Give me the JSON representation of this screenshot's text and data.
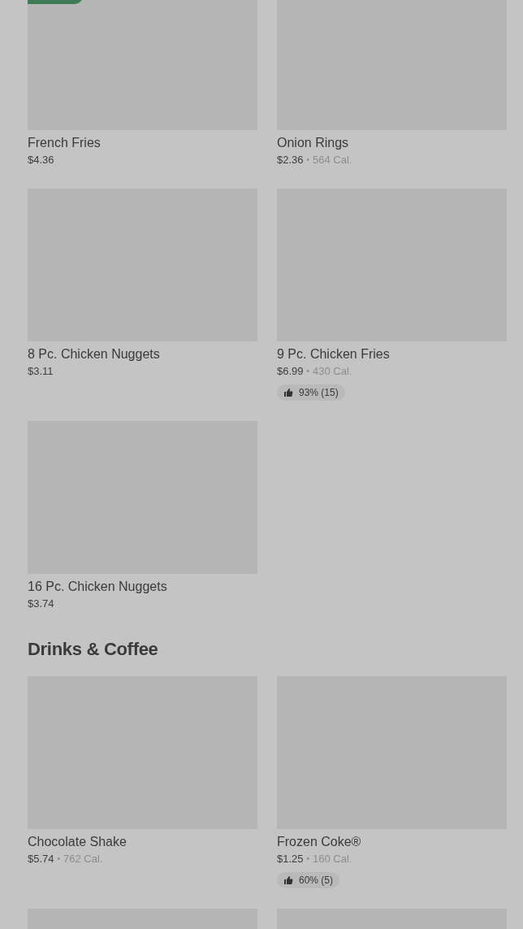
{
  "sections": [
    {
      "items": [
        {
          "name": "French Fries",
          "price": "$4.36",
          "tagged": true
        },
        {
          "name": "Onion Rings",
          "price": "$2.36",
          "separator": "•",
          "calories": "564 Cal.",
          "tagged": false
        },
        {
          "name": "8 Pc. Chicken Nuggets",
          "price": "$3.11",
          "tagged": false
        },
        {
          "name": "9 Pc. Chicken Fries",
          "price": "$6.99",
          "separator": "•",
          "calories": "430 Cal.",
          "rating": "93% (15)",
          "tagged": false
        },
        {
          "name": "16 Pc. Chicken Nuggets",
          "price": "$3.74",
          "tagged": false
        }
      ]
    },
    {
      "title": "Drinks & Coffee",
      "items": [
        {
          "name": "Chocolate Shake",
          "price": "$5.74",
          "separator": "•",
          "calories": "762 Cal.",
          "tagged": false
        },
        {
          "name": "Frozen Coke®",
          "price": "$1.25",
          "separator": "•",
          "calories": "160 Cal.",
          "rating": "60% (5)",
          "tagged": false
        },
        {
          "tagged": false
        },
        {
          "tagged": false
        }
      ]
    }
  ]
}
